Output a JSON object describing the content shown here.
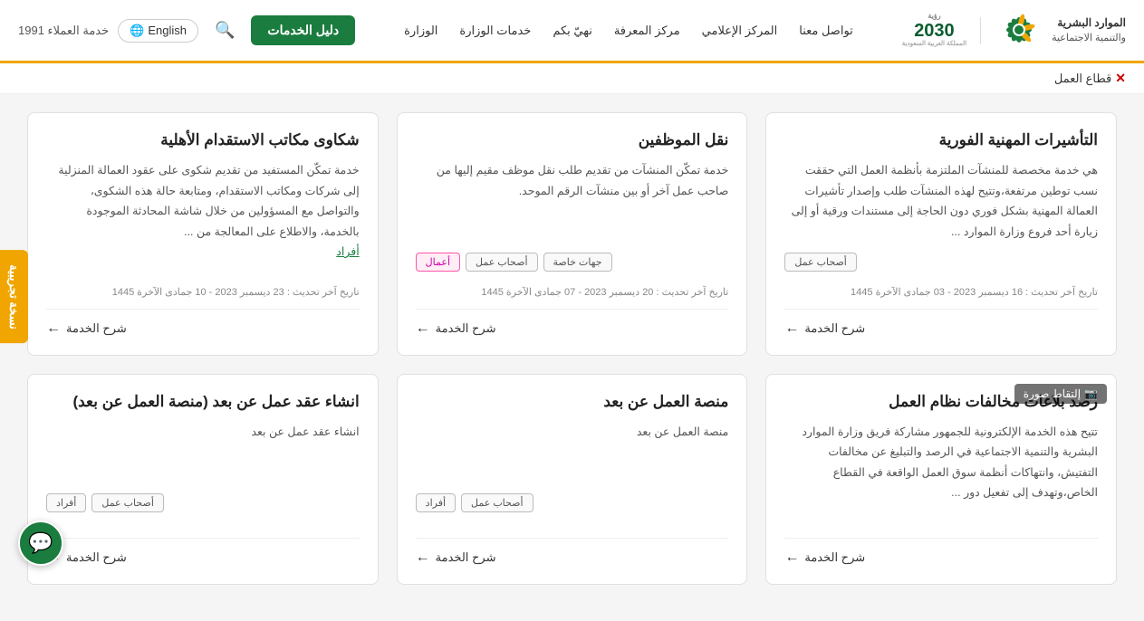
{
  "header": {
    "vision_line1": "رؤية",
    "vision_year": "2030",
    "vision_kingdom": "المملكة العربية السعودية",
    "ministry_name_line1": "الموارد البشرية",
    "ministry_name_line2": "والتنمية الاجتماعية",
    "services_btn": "دليل الخدمات",
    "lang_btn": "English",
    "nav_items": [
      "الوزارة",
      "خدمات الوزارة",
      "نهيّ بكم",
      "مركز المعرفة",
      "المركز الإعلامي",
      "تواصل معنا"
    ],
    "customer_service": "خدمة العملاء 1991"
  },
  "sub_header": {
    "text": "قطاع العمل",
    "close_label": "✕"
  },
  "side_tab": {
    "label": "نسخة تجريبية"
  },
  "cards": [
    {
      "id": "card-1",
      "title": "التأشيرات المهنية الفورية",
      "desc": "هي خدمة مخصصة للمنشآت الملتزمة بأنظمة العمل التي حققت نسب توطين مرتفعة،وتتيح لهذه المنشآت طلب وإصدار تأشيرات العمالة المهنية بشكل فوري دون الحاجة إلى مستندات ورقية أو إلى زيارة أحد فروع وزارة الموارد ...",
      "tags": [
        "أصحاب عمل"
      ],
      "date": "تاريخ آخر تحديث : 16 ديسمبر 2023 - 03 جمادى الآخرة 1445",
      "link": "شرح الخدمة"
    },
    {
      "id": "card-2",
      "title": "نقل الموظفين",
      "desc": "خدمة تمكّن المنشآت من تقديم طلب نقل موظف مقيم إليها من صاحب عمل آخر أو بين منشآت الرقم الموحد.",
      "tags": [
        "جهات خاصة",
        "أصحاب عمل",
        "أعمال"
      ],
      "date": "تاريخ آخر تحديث : 20 ديسمبر 2023 - 07 جمادى الآخرة 1445",
      "link": "شرح الخدمة"
    },
    {
      "id": "card-3",
      "title": "شكاوى مكاتب الاستقدام الأهلية",
      "desc": "خدمة تمكّن المستفيد من تقديم شكوى على عقود العمالة المنزلية إلى شركات ومكاتب الاستقدام، ومتابعة حالة هذه الشكوى، والتواصل مع المسؤولين من خلال شاشة المحادثة الموجودة بالخدمة، والاطلاع على المعالجة من ...",
      "desc_link": "أفراد",
      "tags": [],
      "date": "تاريخ آخر تحديث : 23 ديسمبر 2023 - 10 جمادى الآخرة 1445",
      "link": "شرح الخدمة"
    },
    {
      "id": "card-4",
      "title": "رصد بلاغات مخالفات نظام العمل",
      "desc": "تتيح هذه الخدمة الإلكترونية للجمهور مشاركة فريق وزارة الموارد البشرية والتنمية الاجتماعية في الرصد والتبليغ عن مخالفات التفتيش، وانتهاكات أنظمة سوق العمل الواقعة في القطاع الخاص،وتهدف إلى تفعيل دور ...",
      "tags": [],
      "date": "",
      "link": "شرح الخدمة",
      "has_screenshot": true,
      "screenshot_label": "إلتقاط صورة"
    },
    {
      "id": "card-5",
      "title": "منصة العمل عن بعد",
      "desc": "منصة العمل عن بعد",
      "tags": [
        "أصحاب عمل",
        "أفراد"
      ],
      "date": "",
      "link": "شرح الخدمة"
    },
    {
      "id": "card-6",
      "title": "انشاء عقد عمل عن بعد (منصة العمل عن بعد)",
      "desc": "انشاء عقد عمل عن بعد",
      "tags_bottom": [
        "أصحاب عمل",
        "أفراد"
      ],
      "date": "",
      "link": "شرح الخدمة"
    }
  ],
  "chat_btn": "💬"
}
